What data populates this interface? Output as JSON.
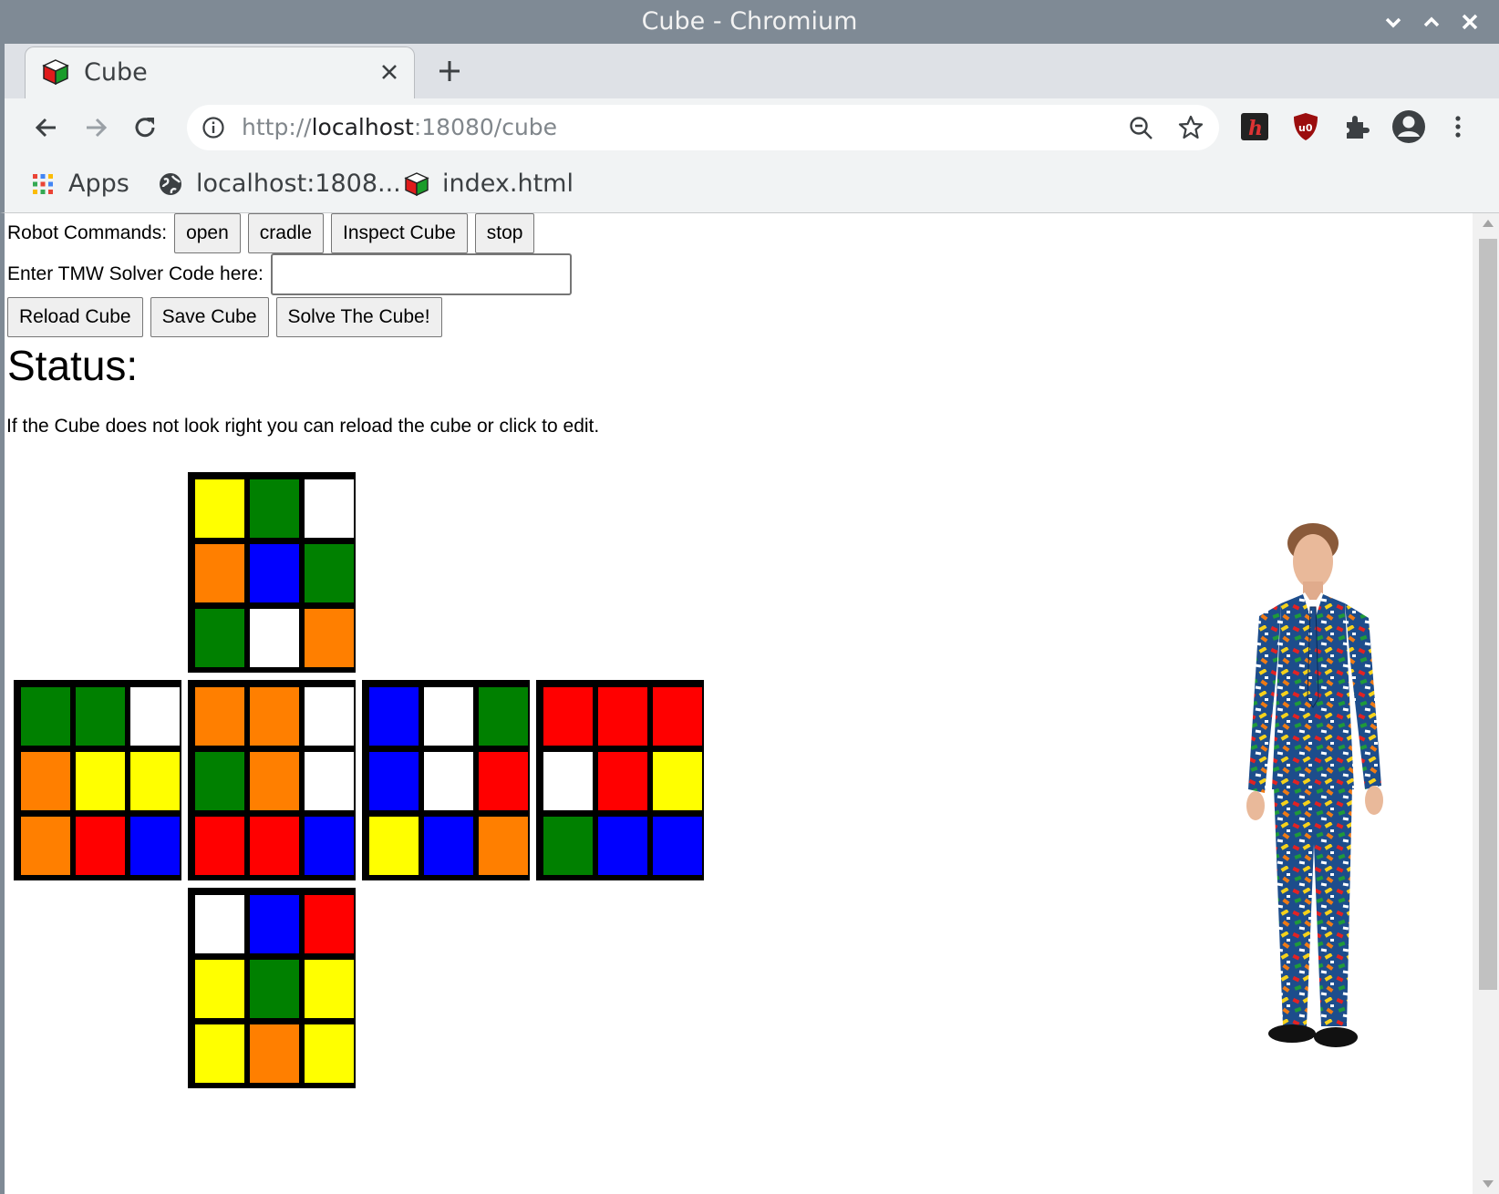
{
  "window": {
    "title": "Cube - Chromium"
  },
  "tab": {
    "title": "Cube"
  },
  "omnibox": {
    "url_prefix": "http://",
    "url_host": "localhost",
    "url_rest": ":18080/cube"
  },
  "bookmarks": [
    {
      "label": "Apps",
      "icon": "apps-grid-icon"
    },
    {
      "label": "localhost:1808...",
      "icon": "globe-icon"
    },
    {
      "label": "index.html",
      "icon": "cube-icon"
    }
  ],
  "robot": {
    "label": "Robot Commands:",
    "buttons": [
      "open",
      "cradle",
      "Inspect Cube",
      "stop"
    ]
  },
  "solver": {
    "label": "Enter TMW Solver Code here:",
    "value": ""
  },
  "cube_actions": [
    "Reload Cube",
    "Save Cube",
    "Solve The Cube!"
  ],
  "status": {
    "heading": "Status:"
  },
  "hint": "If the Cube does not look right you can reload the cube or click to edit.",
  "colors": {
    "Y": "#ffff00",
    "G": "#008000",
    "W": "#ffffff",
    "O": "#ff7f00",
    "B": "#0000ff",
    "R": "#ff0000"
  },
  "cube": {
    "up": [
      "Y",
      "G",
      "W",
      "O",
      "B",
      "G",
      "G",
      "W",
      "O"
    ],
    "left": [
      "G",
      "G",
      "W",
      "O",
      "Y",
      "Y",
      "O",
      "R",
      "B"
    ],
    "front": [
      "O",
      "O",
      "W",
      "G",
      "O",
      "W",
      "R",
      "R",
      "B"
    ],
    "right": [
      "B",
      "W",
      "G",
      "B",
      "W",
      "R",
      "Y",
      "B",
      "O"
    ],
    "back": [
      "R",
      "R",
      "R",
      "W",
      "R",
      "Y",
      "G",
      "B",
      "B"
    ],
    "down": [
      "W",
      "B",
      "R",
      "Y",
      "G",
      "Y",
      "Y",
      "O",
      "Y"
    ]
  }
}
